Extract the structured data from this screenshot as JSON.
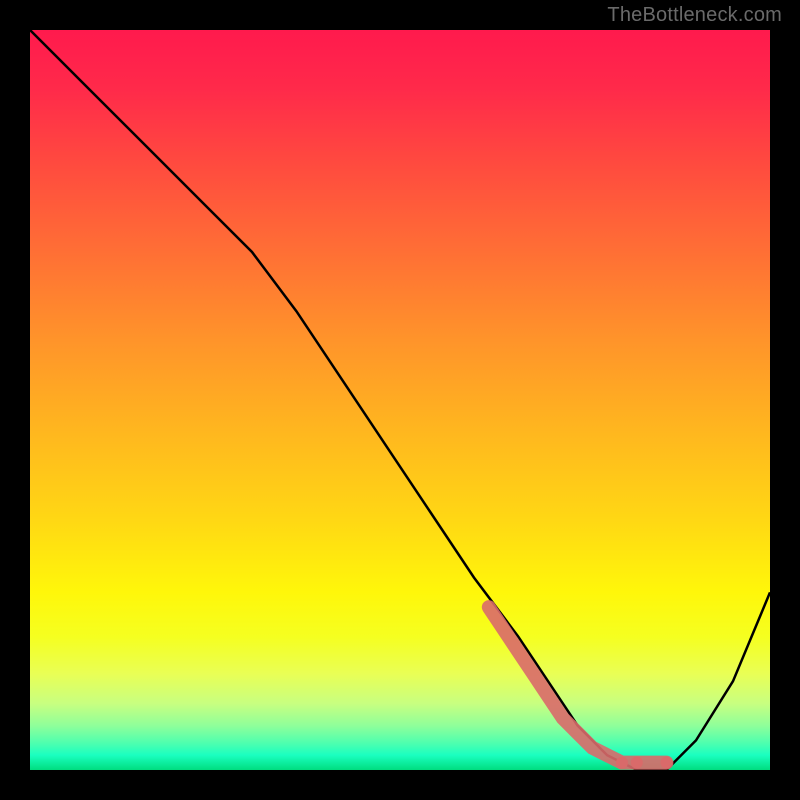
{
  "watermark": "TheBottleneck.com",
  "chart_data": {
    "type": "line",
    "title": "",
    "xlabel": "",
    "ylabel": "",
    "xlim": [
      0,
      100
    ],
    "ylim": [
      0,
      100
    ],
    "series": [
      {
        "name": "curve",
        "x": [
          0,
          8,
          16,
          24,
          30,
          36,
          42,
          48,
          54,
          60,
          66,
          70,
          74,
          78,
          82,
          86,
          90,
          95,
          100
        ],
        "y": [
          100,
          92,
          84,
          76,
          70,
          62,
          53,
          44,
          35,
          26,
          18,
          12,
          6,
          2,
          0,
          0,
          4,
          12,
          24
        ]
      },
      {
        "name": "highlight-dots",
        "x": [
          62,
          64,
          66,
          68,
          70,
          72,
          74,
          76,
          78,
          80,
          82,
          86
        ],
        "y": [
          22,
          19,
          16,
          13,
          10,
          7,
          5,
          3,
          2,
          1,
          1,
          1
        ]
      }
    ],
    "colors": {
      "curve": "#000000",
      "dots": "#d96a6a",
      "gradient_top": "#ff1a4d",
      "gradient_bottom": "#00dd7f"
    }
  }
}
